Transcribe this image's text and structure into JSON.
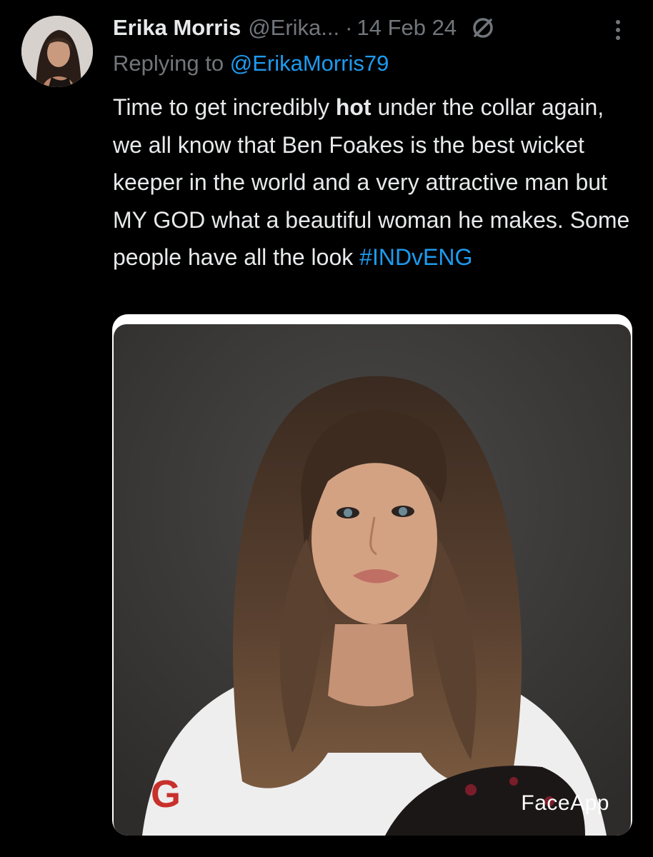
{
  "tweet": {
    "display_name": "Erika Morris",
    "handle": "@Erika...",
    "separator": "·",
    "date": "14 Feb 24",
    "reply_prefix": "Replying to",
    "reply_to": "@ErikaMorris79",
    "text_part1": "Time to get incredibly ",
    "text_bold": "hot",
    "text_part2": " under the collar again, we all know that Ben Foakes is the best wicket keeper in the world and a very attractive man but MY GOD what a beautiful woman he makes. Some people have all the look ",
    "hashtag": "#INDvENG"
  },
  "media": {
    "watermark": "FaceApp"
  },
  "icons": {
    "avatar": "avatar",
    "no_symbol": "no-symbol-icon",
    "more": "more-vertical-icon"
  },
  "colors": {
    "background": "#000000",
    "text": "#e7e9ea",
    "muted": "#71767b",
    "link": "#1d9bf0"
  }
}
